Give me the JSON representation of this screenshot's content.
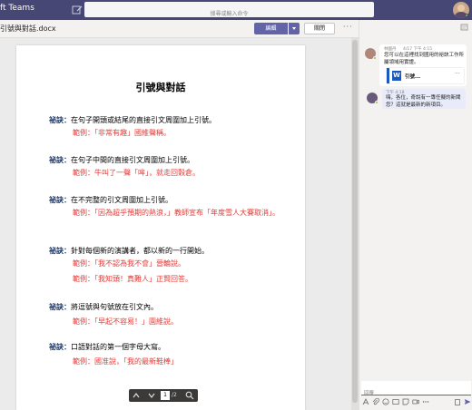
{
  "app": {
    "name": "ft Teams"
  },
  "search": {
    "placeholder": "搜尋或輸入命令"
  },
  "document": {
    "file_name": "引號與對話.docx",
    "edit_label": "編輯",
    "close_label": "關閉",
    "more_label": "···",
    "title": "引號與對話",
    "sections": [
      {
        "keyword": "祕訣：",
        "tip": "在句子開頭或結尾的直接引文周圍加上引號。",
        "examples": [
          "範例：「非常有趣」國維聲稱。"
        ]
      },
      {
        "keyword": "祕訣：",
        "tip": "在句子中間的直接引文周圍加上引號。",
        "examples": [
          "範例：牛叫了一聲「哞」，就走回穀倉。"
        ]
      },
      {
        "keyword": "祕訣：",
        "tip": "在不完整的引文周圍加上引號。",
        "examples": [
          "範例：「因為超乎預期的熱浪，」教師宣布「年度雪人大賽取消」。"
        ]
      },
      {
        "keyword": "祕訣：",
        "tip": "針對每個新的演講者，都以新的一行開始。",
        "examples": [
          "範例：「我不認為我不會」晉輪說。",
          "範例：「我知頭！真難人」正賢回答。"
        ]
      },
      {
        "keyword": "祕訣：",
        "tip": "將逗號與句號放在引文內。",
        "examples": [
          "範例：「早起不容易！」園維說。"
        ]
      },
      {
        "keyword": "祕訣：",
        "tip": "口語對話的第一個字母大寫。",
        "examples": [
          "範例：國准說，「我的最新鞋棒」"
        ]
      }
    ]
  },
  "pager": {
    "current": "1",
    "total": "/2"
  },
  "chat": {
    "messages": [
      {
        "author": "林國丹",
        "time": "4/17 下午 4:15",
        "text": "您可以在這裡找到國用的祕訣工作所屬領域用實證。",
        "file_name": "引號...",
        "file_more": "···"
      },
      {
        "author": "",
        "time": "下午 4:18",
        "text": "嗨，各位，奇說有一專任擬的新聞您？這就是最新的新項目。"
      }
    ],
    "composer_placeholder": "回覆"
  },
  "colors": {
    "titlebar": "#464775",
    "accent": "#6264a7",
    "keyword": "#1f3864",
    "example": "#e53935"
  }
}
